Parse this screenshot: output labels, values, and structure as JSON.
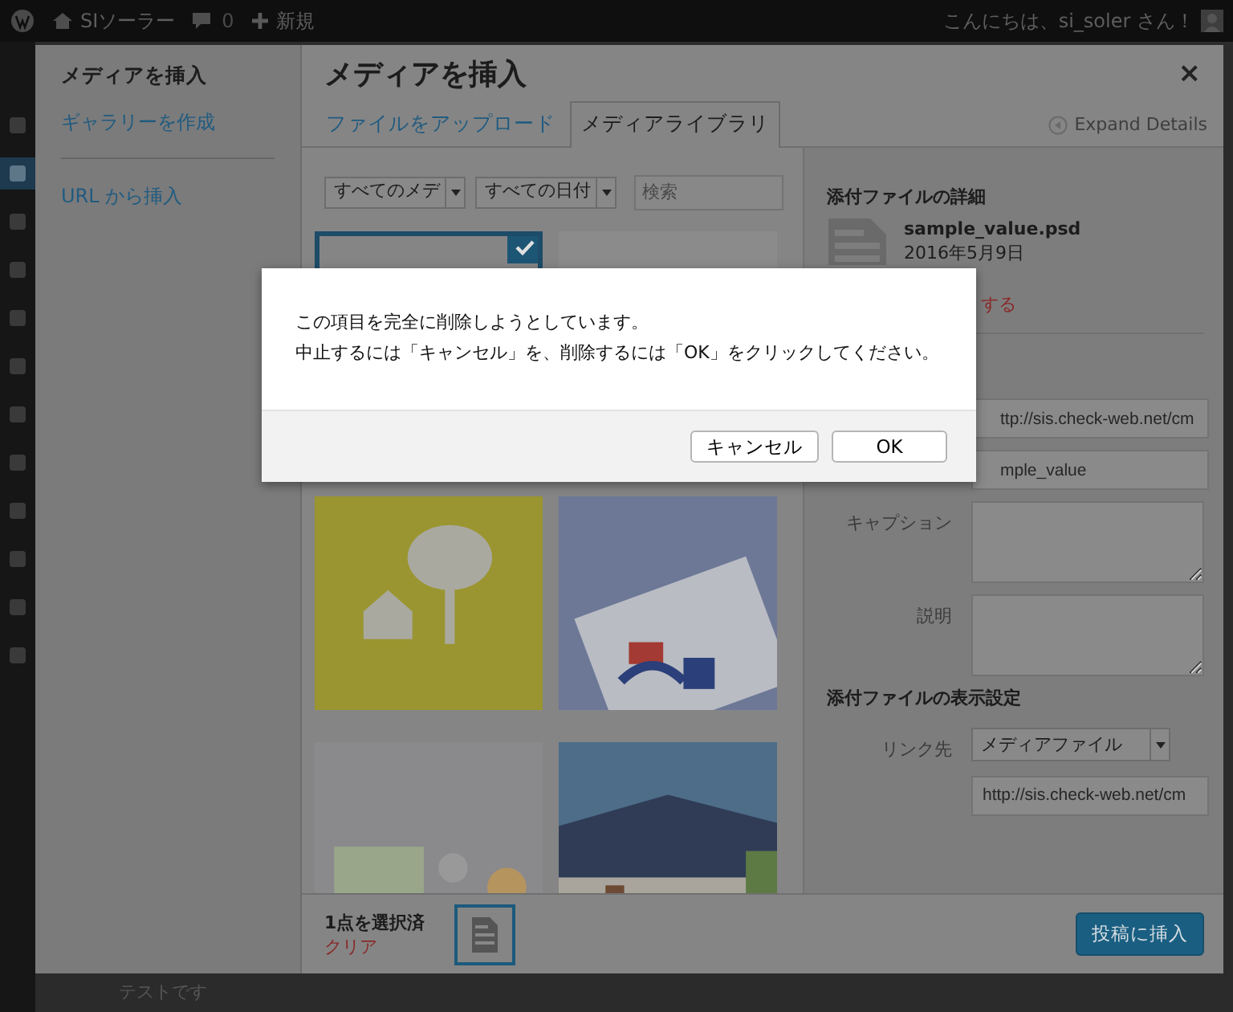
{
  "admin_bar": {
    "site_name": "SIソーラー",
    "comments": "0",
    "new": "新規",
    "greeting": "こんにちは、si_soler さん！"
  },
  "admin_menu": [
    {
      "selected": false
    },
    {
      "selected": true
    },
    {
      "selected": false
    },
    {
      "selected": false
    },
    {
      "selected": false
    },
    {
      "selected": false
    },
    {
      "selected": false
    },
    {
      "selected": false
    },
    {
      "selected": false
    },
    {
      "selected": false
    },
    {
      "selected": false
    },
    {
      "selected": false
    }
  ],
  "modal": {
    "sidebar": {
      "heading": "メディアを挿入",
      "items": [
        {
          "label": "ギャラリーを作成"
        },
        {
          "label": "URL から挿入"
        }
      ]
    },
    "title": "メディアを挿入",
    "close": "×",
    "tabs": [
      {
        "label": "ファイルをアップロード",
        "selected": false
      },
      {
        "label": "メディアライブラリ",
        "selected": true
      }
    ],
    "expand_details": "Expand Details",
    "filters": [
      {
        "value": "すべてのメデ"
      },
      {
        "value": "すべての日付"
      }
    ],
    "search": {
      "placeholder": "検索"
    },
    "attachments": [
      {
        "kind": "file",
        "selected": true
      },
      {
        "kind": "picture",
        "selected": false
      },
      {
        "kind": "picture",
        "selected": false
      },
      {
        "kind": "picture",
        "selected": false
      },
      {
        "kind": "picture",
        "selected": false
      },
      {
        "kind": "picture",
        "selected": false
      }
    ],
    "details": {
      "heading": "添付ファイルの詳細",
      "filename": "sample_value.psd",
      "date": "2016年5月9日",
      "delete": "する",
      "fields": [
        {
          "kind": "input",
          "value": "ttp://sis.check-web.net/cm"
        },
        {
          "kind": "input",
          "value": "mple_value"
        },
        {
          "kind": "textarea",
          "label": "キャプション"
        },
        {
          "kind": "textarea",
          "label": "説明"
        }
      ]
    },
    "display_settings": {
      "heading": "添付ファイルの表示設定",
      "link_label": "リンク先",
      "link_value": "メディアファイル",
      "url": "http://sis.check-web.net/cm"
    },
    "selection": {
      "count": "1点を選択済",
      "clear": "クリア"
    },
    "insert_button": "投稿に挿入"
  },
  "background_text": "テストです",
  "confirm": {
    "lines": [
      "この項目を完全に削除しようとしています。",
      "中止するには「キャンセル」を、削除するには「OK」をクリックしてください。"
    ],
    "buttons": [
      "キャンセル",
      "OK"
    ]
  }
}
